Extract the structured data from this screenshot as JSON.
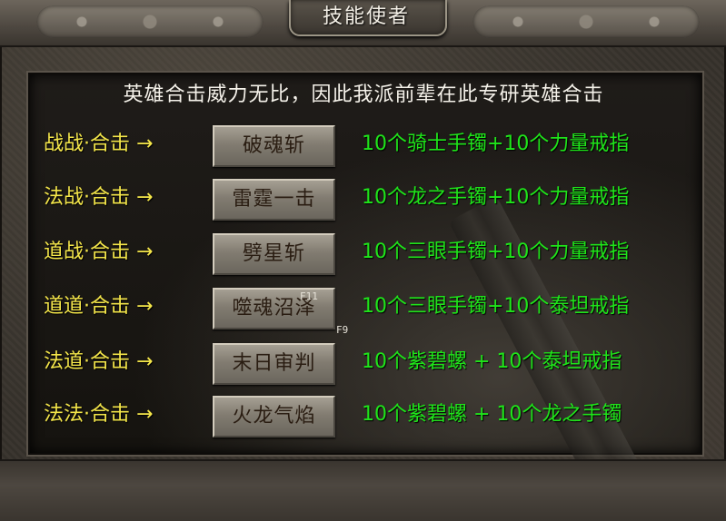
{
  "window": {
    "title": "技能使者"
  },
  "intro": "英雄合击威力无比，因此我派前辈在此专研英雄合击",
  "arrow": "→",
  "skills": [
    {
      "combo": "战战·合击",
      "skill": "破魂斩",
      "requirement": "10个骑士手镯+10个力量戒指"
    },
    {
      "combo": "法战·合击",
      "skill": "雷霆一击",
      "requirement": "10个龙之手镯+10个力量戒指"
    },
    {
      "combo": "道战·合击",
      "skill": "劈星斩",
      "requirement": "10个三眼手镯+10个力量戒指"
    },
    {
      "combo": "道道·合击",
      "skill": "噬魂沼泽",
      "requirement": "10个三眼手镯+10个泰坦戒指"
    },
    {
      "combo": "法道·合击",
      "skill": "末日审判",
      "requirement": "10个紫碧螺 + 10个泰坦戒指"
    },
    {
      "combo": "法法·合击",
      "skill": "火龙气焰",
      "requirement": "10个紫碧螺 + 10个龙之手镯"
    }
  ],
  "hotkeys": {
    "f11": "F11",
    "f9": "F9"
  },
  "icons": {
    "ornament": "dragon-ornament-icon"
  },
  "colors": {
    "combo_text": "#f4e64a",
    "requirement_text": "#1fe41a",
    "headline_text": "#f5f2ea"
  }
}
